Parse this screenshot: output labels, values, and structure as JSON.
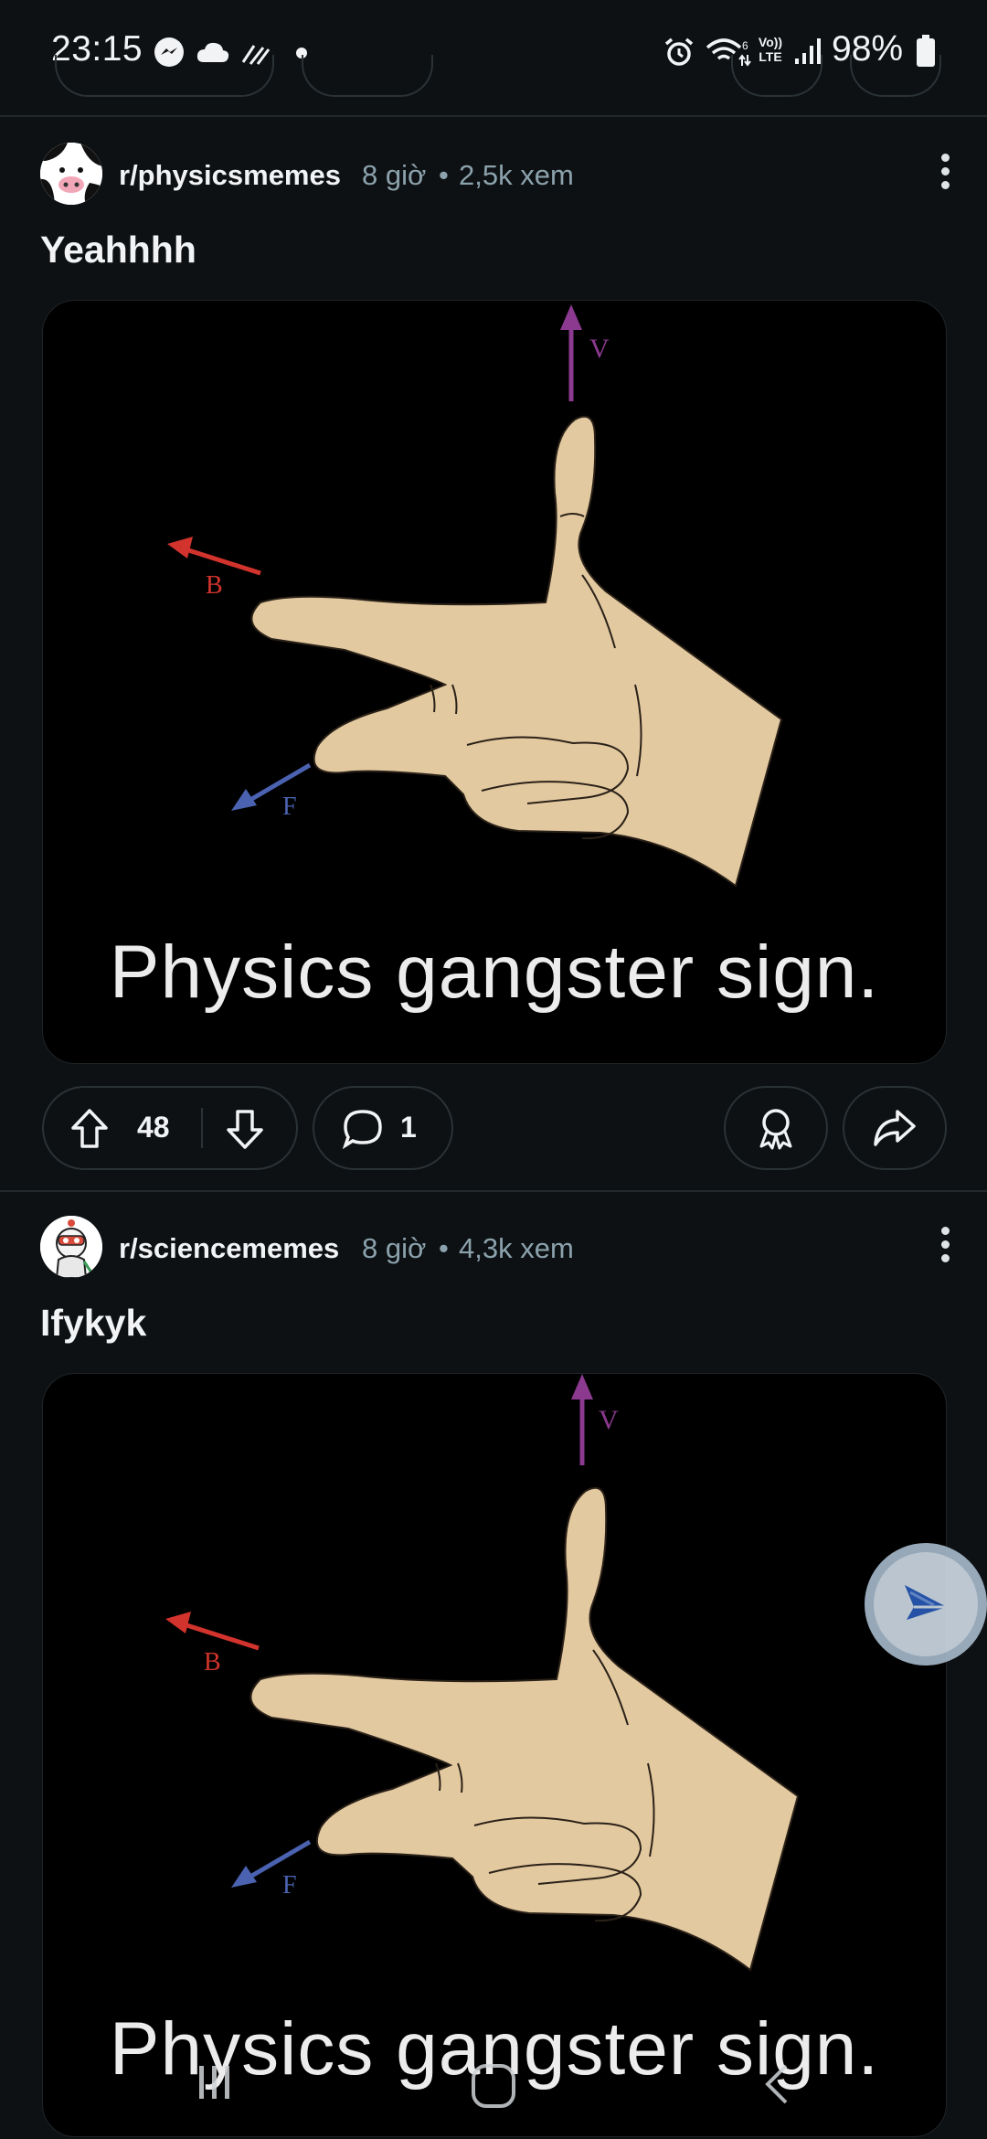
{
  "status_bar": {
    "time": "23:15",
    "battery": "98%",
    "left_icons": [
      "messenger-icon",
      "cloud-icon",
      "data-sync-icon",
      "dot-icon"
    ],
    "right_icons": [
      "alarm-icon",
      "wifi-icon",
      "volte-icon",
      "signal-icon",
      "battery-icon"
    ],
    "volte_label": "Vo)) LTE"
  },
  "posts": [
    {
      "subreddit": "r/physicsmemes",
      "age": "8 giờ",
      "views": "2,5k xem",
      "title": "Yeahhhh",
      "caption": "Physics gangster sign.",
      "labels": {
        "v": "V",
        "b": "B",
        "f": "F"
      },
      "upvotes": "48",
      "comments": "1"
    },
    {
      "subreddit": "r/sciencememes",
      "age": "8 giờ",
      "views": "4,3k xem",
      "title": "Ifykyk",
      "caption": "Physics gangster sign.",
      "labels": {
        "v": "V",
        "b": "B",
        "f": "F"
      }
    }
  ],
  "separator": "•",
  "colors": {
    "background": "#0e1113",
    "meta_text": "#8ba2ad",
    "arrow_v": "#8b3a8f",
    "arrow_b": "#d2332c",
    "arrow_f": "#4a62b0",
    "hand": "#e3c9a0"
  }
}
